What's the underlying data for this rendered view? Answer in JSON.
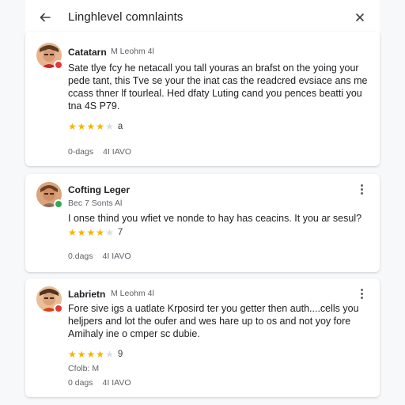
{
  "header": {
    "title": "Linghlevel comnlaints",
    "back_icon": "arrow-left-icon",
    "close_icon": "close-icon",
    "accent_color": "#f4b400"
  },
  "reviews": [
    {
      "name": "Catatarn",
      "meta": "M Leohm 4l",
      "badge_color": "#e53935",
      "text_lines": [
        "Sate tlye fcy he netacall you tall youras an brafst on the yoing your",
        "pede tant, this Tve se your the inat cas the readcred evsiace ans me",
        "ccass thner lf tourleal. Hed dfaty Luting cand you pences beatti you",
        "tna 4S P79."
      ],
      "stars": 4,
      "rating": "a",
      "footer": [
        "0-dags",
        "4I IAVO"
      ]
    },
    {
      "name": "Cofting Leger",
      "meta": "Bec 7 Sonts Al",
      "badge_color": "#34a853",
      "text_lines": [
        "I onse thind you wfiet ve nonde to hay has ceacins. It you ar sesul?"
      ],
      "stars": 4,
      "rating": "7",
      "footer": [
        "0.dags",
        "4I IAVO"
      ]
    },
    {
      "name": "Labrietn",
      "meta": "M Leohm 4l",
      "badge_color": "#e53935",
      "text_lines": [
        "Fore sive igs a uatlate Krposird ter you getter then auth....cells you",
        "heljpers and lot the oufer and wes hare up to os and not yoy fore",
        "Amihaly ine o cmper sc dubie."
      ],
      "stars": 4,
      "rating": "9",
      "sub": "Cfolb: M",
      "footer": [
        "0 dags",
        "4I IAVO"
      ]
    }
  ]
}
